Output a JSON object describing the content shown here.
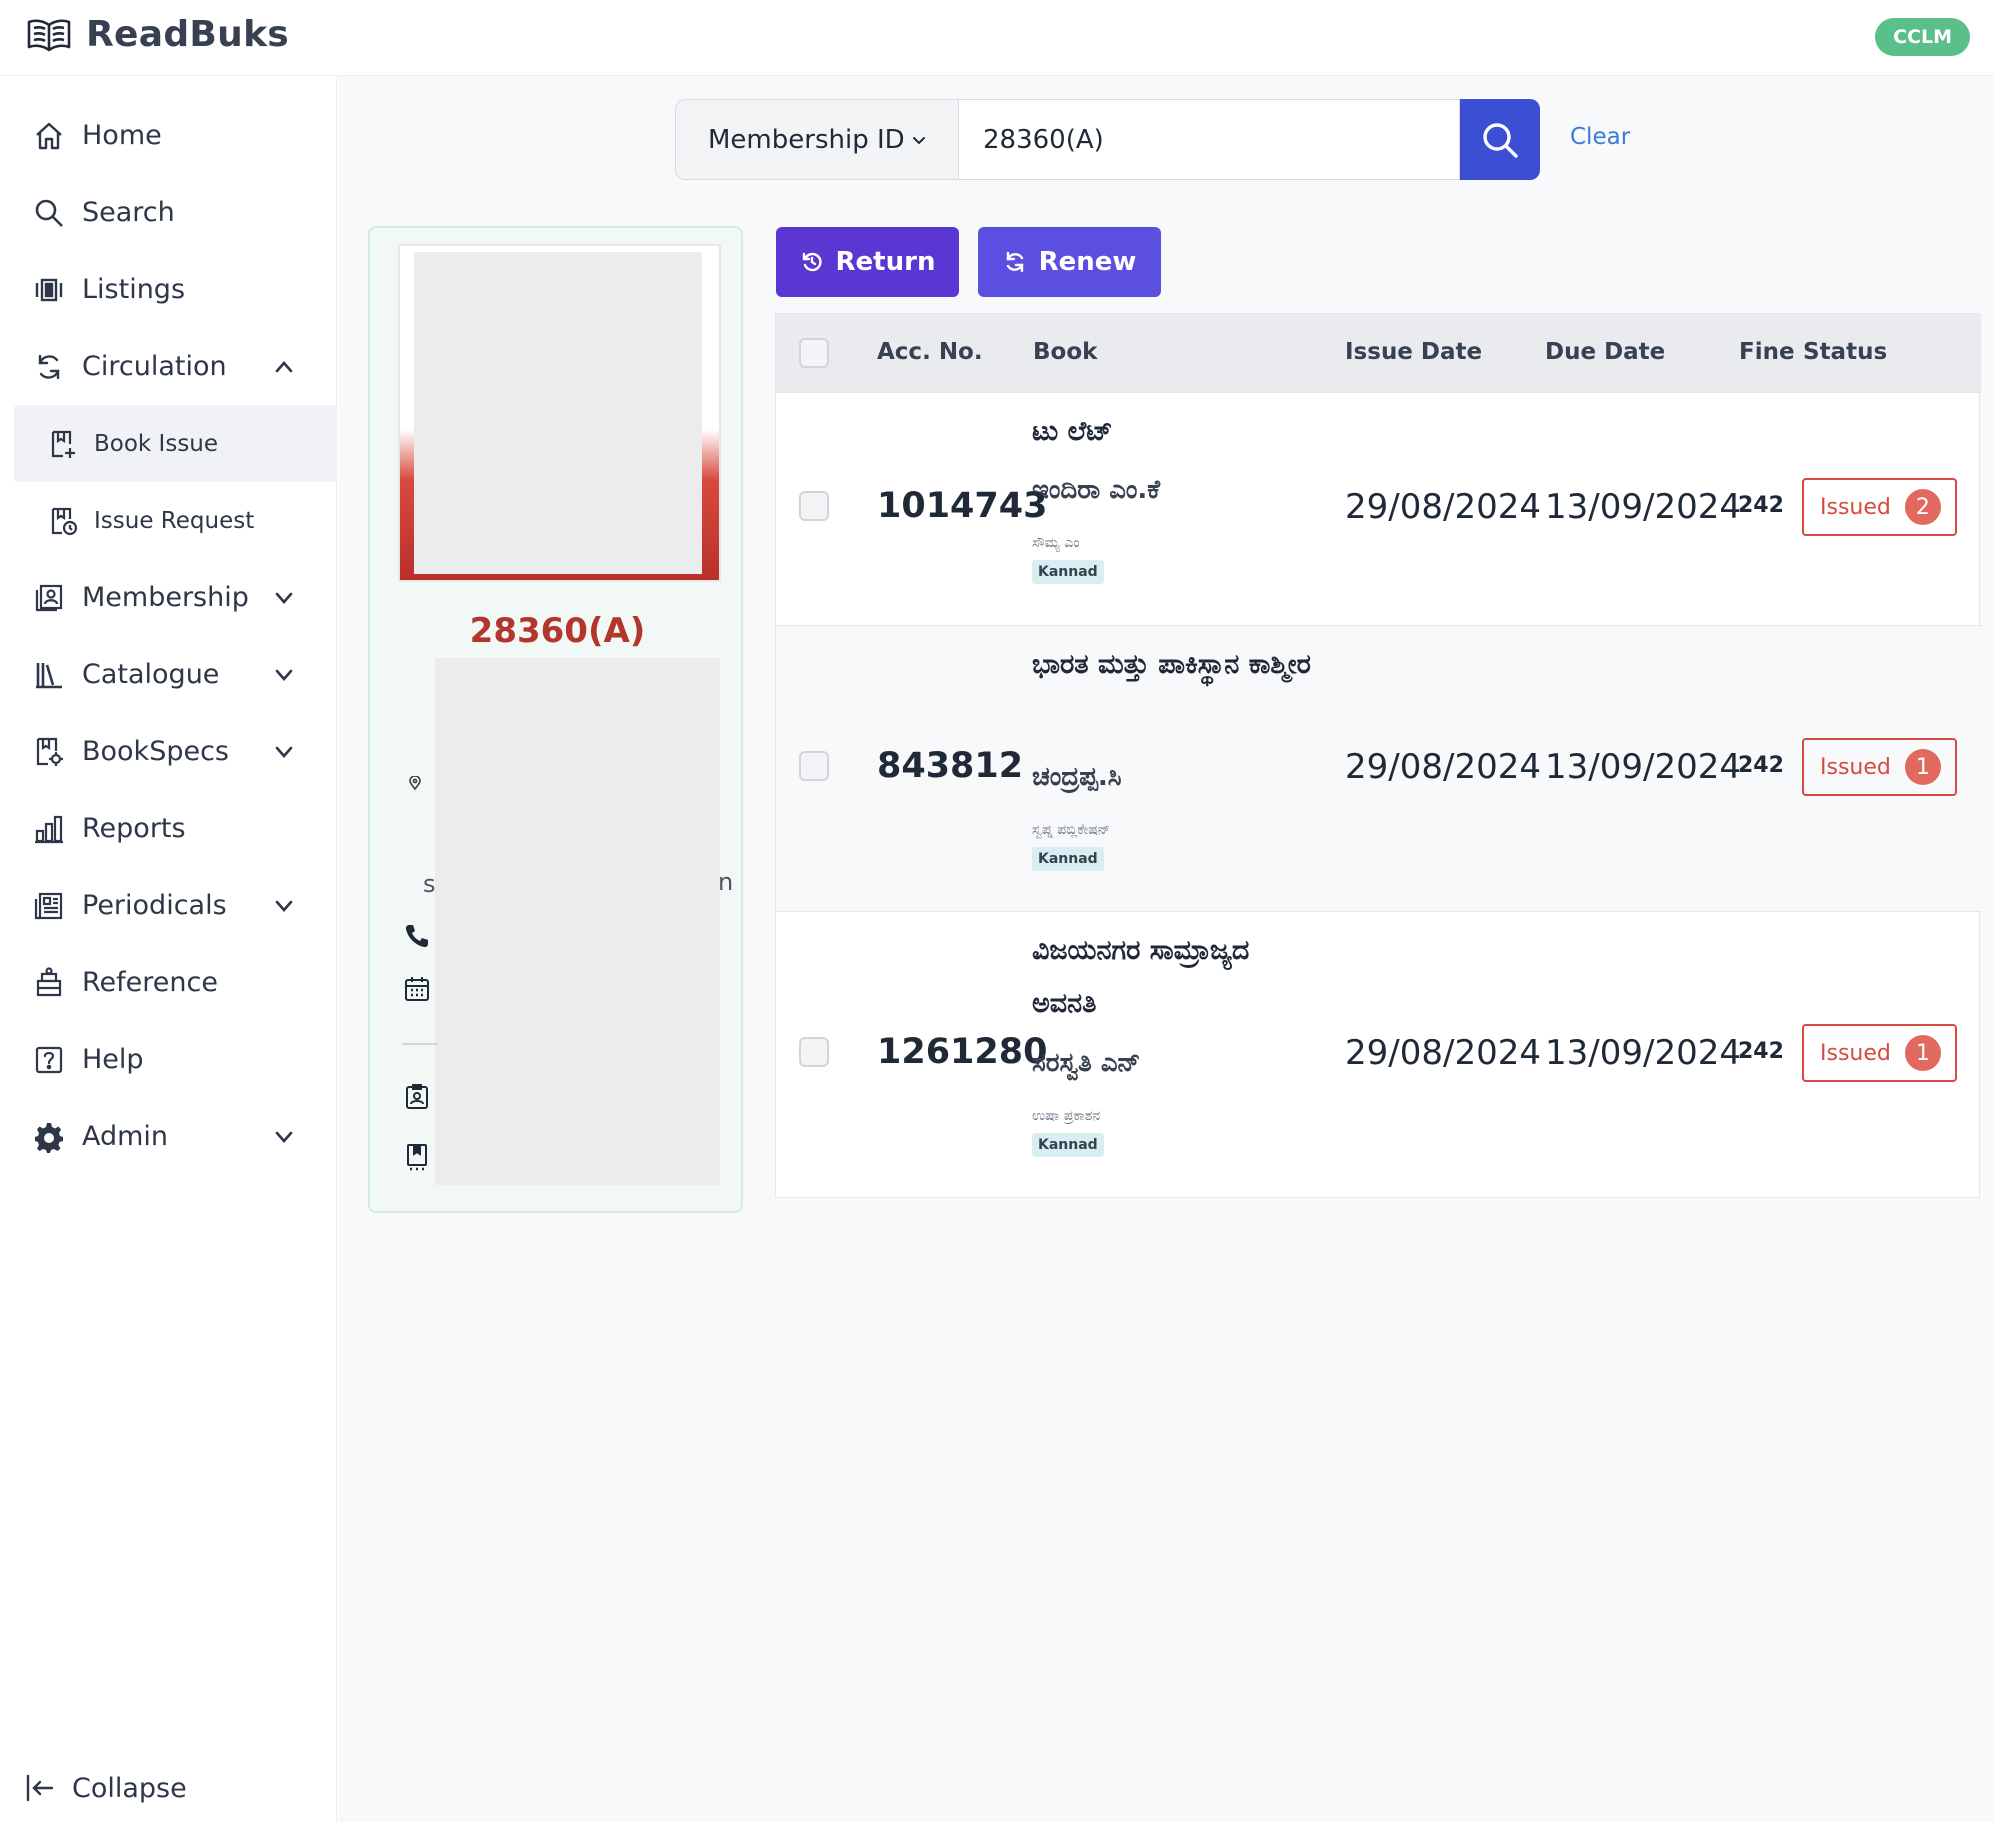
{
  "app": {
    "name": "ReadBuks",
    "badge": "CCLM"
  },
  "sidebar": {
    "items": [
      {
        "label": "Home",
        "icon": "home-icon"
      },
      {
        "label": "Search",
        "icon": "search-icon"
      },
      {
        "label": "Listings",
        "icon": "listings-icon"
      },
      {
        "label": "Circulation",
        "icon": "circulation-icon",
        "expanded": true,
        "children": [
          {
            "label": "Book Issue",
            "icon": "book-issue-icon",
            "active": true
          },
          {
            "label": "Issue Request",
            "icon": "issue-request-icon"
          }
        ]
      },
      {
        "label": "Membership",
        "icon": "membership-icon"
      },
      {
        "label": "Catalogue",
        "icon": "catalogue-icon"
      },
      {
        "label": "BookSpecs",
        "icon": "bookspecs-icon"
      },
      {
        "label": "Reports",
        "icon": "reports-icon"
      },
      {
        "label": "Periodicals",
        "icon": "periodicals-icon"
      },
      {
        "label": "Reference",
        "icon": "reference-icon"
      },
      {
        "label": "Help",
        "icon": "help-icon"
      },
      {
        "label": "Admin",
        "icon": "admin-icon"
      }
    ],
    "collapse_label": "Collapse"
  },
  "search": {
    "field_selector": "Membership ID",
    "value": "28360(A)",
    "clear_label": "Clear"
  },
  "member": {
    "id": "28360(A)",
    "partial_left": "s",
    "partial_right": "n"
  },
  "actions": {
    "return_label": "Return",
    "renew_label": "Renew"
  },
  "table": {
    "headers": {
      "acc_no": "Acc. No.",
      "book": "Book",
      "issue_date": "Issue Date",
      "due_date": "Due Date",
      "fine": "Fine",
      "status": "Status"
    },
    "rows": [
      {
        "acc_no": "1014743",
        "title": "ಟು ಲೆಟ್",
        "author": "ಇಂದಿರಾ ಎಂ.ಕೆ",
        "publisher": "ಸೌಮ್ಯ ಎಂ",
        "language": "Kannad",
        "issue_date": "29/08/2024",
        "due_date": "13/09/2024",
        "fine": "242",
        "status": "Issued",
        "status_count": "2"
      },
      {
        "acc_no": "843812",
        "title": "ಭಾರತ ಮತ್ತು ಪಾಕಿಸ್ಥಾನ ಕಾಶ್ಮೀರ",
        "author": "ಚಂದ್ರಪ್ಪ.ಸಿ",
        "publisher": "ಸ್ವಪ್ನ ಪಬ್ಲಿಕೇಷನ್",
        "language": "Kannad",
        "issue_date": "29/08/2024",
        "due_date": "13/09/2024",
        "fine": "242",
        "status": "Issued",
        "status_count": "1"
      },
      {
        "acc_no": "1261280",
        "title": "ವಿಜಯನಗರ ಸಾಮ್ರಾಜ್ಯದ ಅವನತಿ",
        "author": "ಸರಸ್ವತಿ ಎನ್",
        "publisher": "ಉಷಾ ಪ್ರಕಾಶನ",
        "language": "Kannad",
        "issue_date": "29/08/2024",
        "due_date": "13/09/2024",
        "fine": "242",
        "status": "Issued",
        "status_count": "1"
      }
    ]
  },
  "colors": {
    "primary": "#5a37d2",
    "search_button": "#3b4fd4",
    "issued_red": "#d64a3f",
    "member_id_red": "#b3362d",
    "badge_green": "#5bbf8a"
  }
}
